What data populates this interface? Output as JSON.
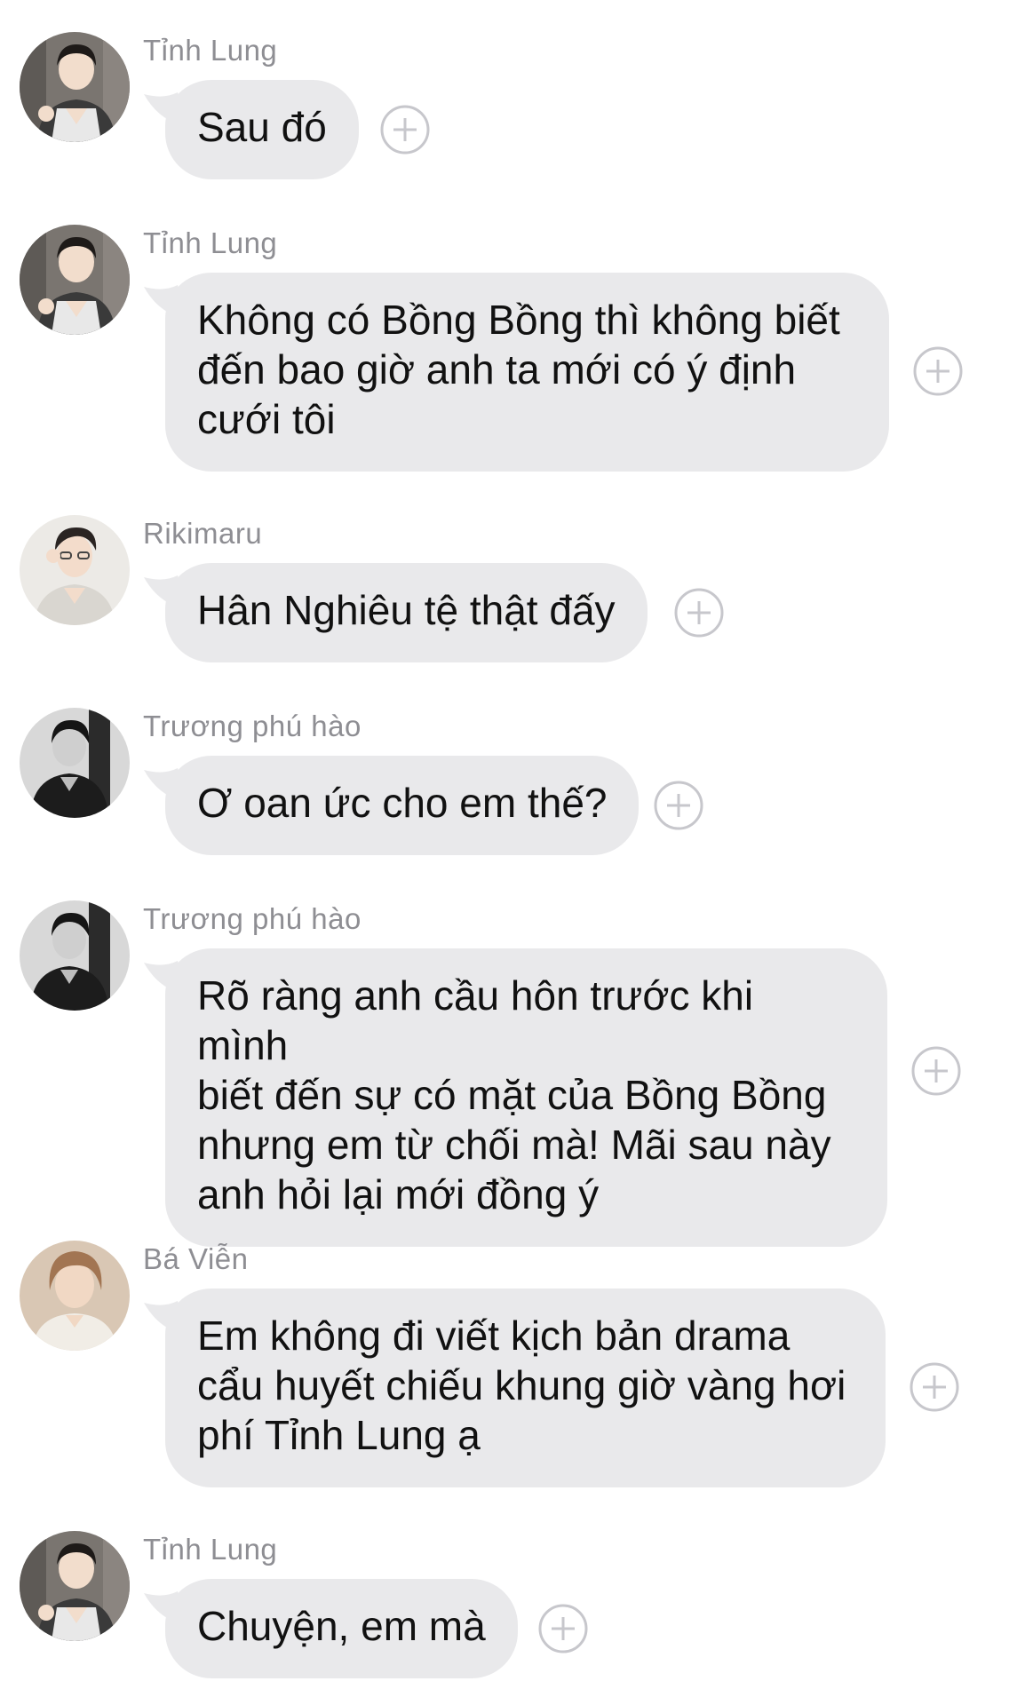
{
  "colors": {
    "bubble": "#e9e9eb",
    "sender_text": "#8e8e93",
    "message_text": "#111111",
    "add_icon": "#c7c7cc"
  },
  "messages": [
    {
      "sender": "Tỉnh Lung",
      "avatar": "avatar-tinh-lung",
      "text": "Sau đó",
      "action_icon": "add-circle-icon"
    },
    {
      "sender": "Tỉnh Lung",
      "avatar": "avatar-tinh-lung",
      "text": "Không có Bồng Bồng thì không biết\nđến bao giờ anh ta mới có ý định\ncưới tôi",
      "action_icon": "add-circle-icon"
    },
    {
      "sender": "Rikimaru",
      "avatar": "avatar-rikimaru",
      "text": "Hân Nghiêu tệ thật đấy",
      "action_icon": "add-circle-icon"
    },
    {
      "sender": "Trương phú hào",
      "avatar": "avatar-truong-phu-hao",
      "text": "Ơ oan ức cho em thế?",
      "action_icon": "add-circle-icon"
    },
    {
      "sender": "Trương phú hào",
      "avatar": "avatar-truong-phu-hao",
      "text": "Rõ ràng anh cầu hôn trước khi mình\nbiết đến sự có mặt của Bồng Bồng\nnhưng em từ chối mà! Mãi sau này\nanh hỏi lại mới đồng ý",
      "action_icon": "add-circle-icon"
    },
    {
      "sender": "Bá Viễn",
      "avatar": "avatar-ba-vien",
      "text": "Em không đi viết kịch bản drama\ncẩu huyết chiếu khung giờ vàng hơi\nphí Tỉnh Lung ạ",
      "action_icon": "add-circle-icon"
    },
    {
      "sender": "Tỉnh Lung",
      "avatar": "avatar-tinh-lung",
      "text": "Chuyện, em mà",
      "action_icon": "add-circle-icon"
    }
  ]
}
